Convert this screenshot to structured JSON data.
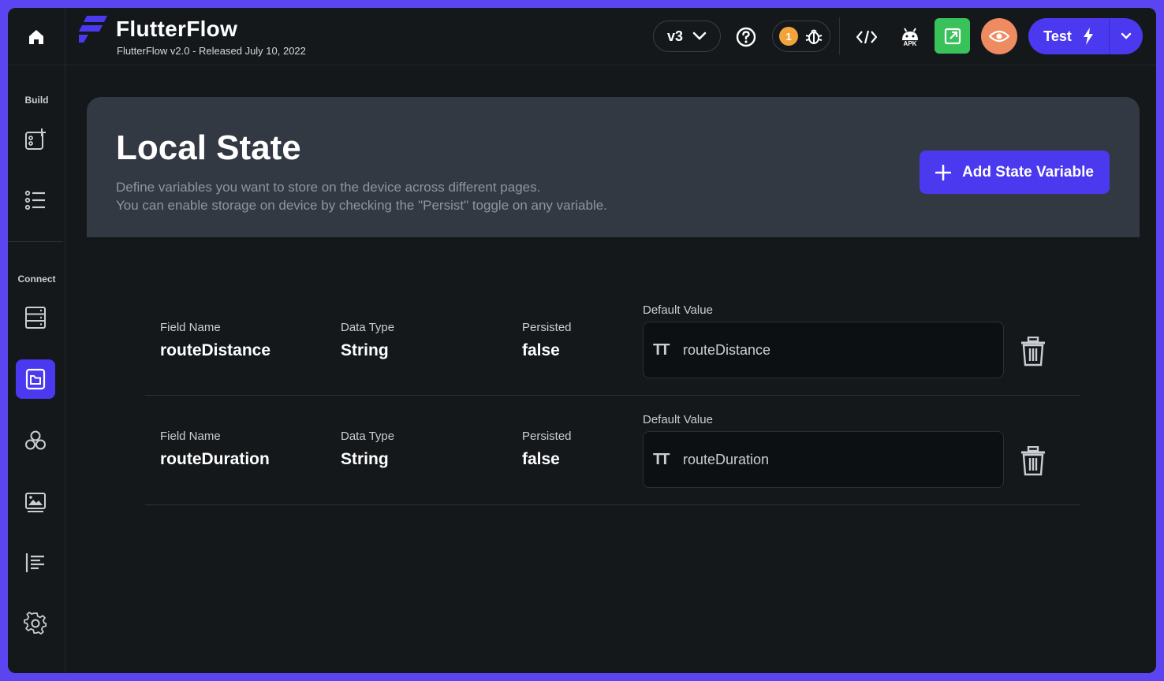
{
  "app": {
    "title": "FlutterFlow",
    "subtitle": "FlutterFlow v2.0 - Released July 10, 2022",
    "accent_color": "#4b39ef"
  },
  "toolbar": {
    "version_label": "v3",
    "bug_count": "1",
    "apk_label": "APK",
    "test_label": "Test"
  },
  "sidebar": {
    "build_label": "Build",
    "connect_label": "Connect",
    "items": [
      {
        "icon": "add-widget-icon"
      },
      {
        "icon": "list-icon"
      },
      {
        "icon": "database-icon"
      },
      {
        "icon": "local-state-icon",
        "active": true
      },
      {
        "icon": "integrations-icon"
      },
      {
        "icon": "media-assets-icon"
      },
      {
        "icon": "text-format-icon"
      },
      {
        "icon": "settings-gear-icon"
      }
    ]
  },
  "page": {
    "title": "Local State",
    "description_line1": "Define variables you want to store on the device across different pages.",
    "description_line2": "You can enable storage on device by checking the \"Persist\" toggle on any variable.",
    "add_button_label": "Add State Variable"
  },
  "columns": {
    "field_name": "Field Name",
    "data_type": "Data Type",
    "persisted": "Persisted",
    "default_value": "Default Value"
  },
  "variables": [
    {
      "field_name": "routeDistance",
      "data_type": "String",
      "persisted": "false",
      "default_value": "routeDistance"
    },
    {
      "field_name": "routeDuration",
      "data_type": "String",
      "persisted": "false",
      "default_value": "routeDuration"
    }
  ]
}
